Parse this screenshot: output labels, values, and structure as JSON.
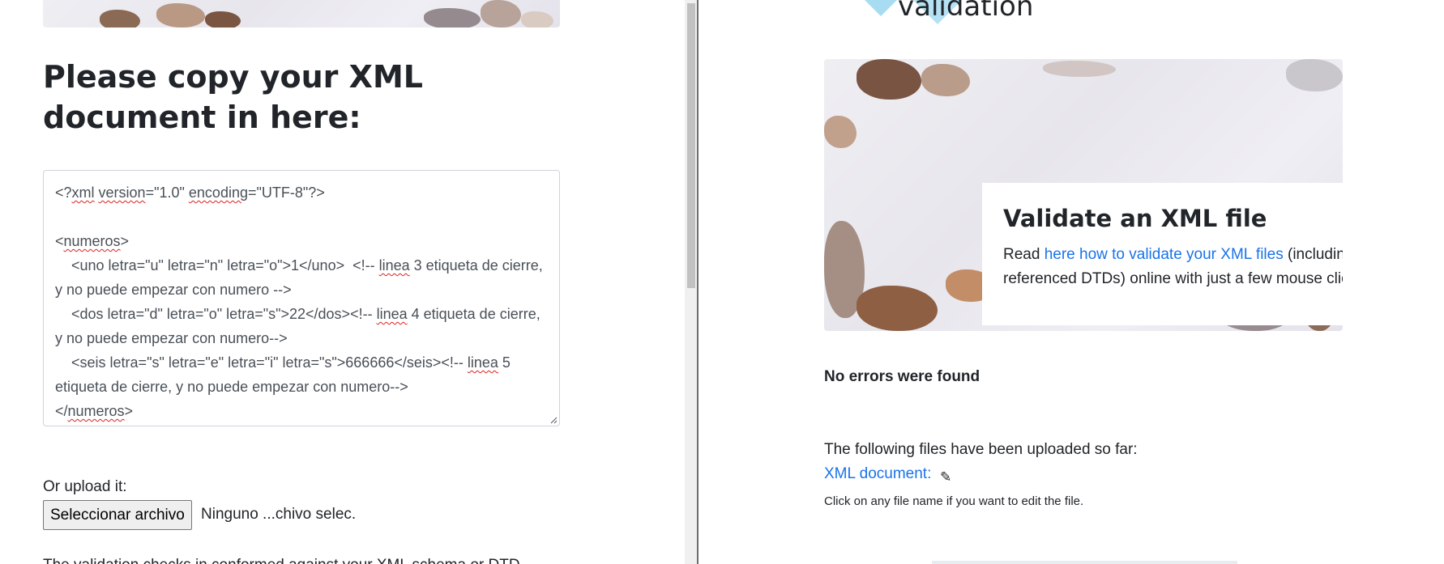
{
  "left": {
    "page_title": "Please copy your XML document in here:",
    "xml_lines": [
      "<?xml version=\"1.0\" encoding=\"UTF-8\"?>",
      "",
      "<numeros>",
      "    <uno letra=\"u\" letra=\"n\" letra=\"o\">1</uno>  <!-- linea 3 etiqueta de cierre, y no puede empezar con numero -->",
      "    <dos letra=\"d\" letra=\"o\" letra=\"s\">22</dos><!-- linea 4 etiqueta de cierre, y no puede empezar con numero-->",
      "    <seis letra=\"s\" letra=\"e\" letra=\"i\" letra=\"s\">666666</seis><!-- linea 5 etiqueta de cierre, y no puede empezar con numero-->",
      "</numeros>"
    ],
    "upload_label": "Or upload it:",
    "file_button_label": "Seleccionar archivo",
    "file_status": "Ninguno ...chivo selec.",
    "cutoff_text": "The validation checks in conformed against your XML schema or DTD"
  },
  "right": {
    "header_text": "validation",
    "card_title": "Validate an XML file",
    "card_text_before": "Read ",
    "card_link": "here how to validate your XML files",
    "card_text_after": " (including referenced DTDs) online with just a few mouse clicks.",
    "no_errors": "No errors were found",
    "files_intro": "The following files have been uploaded so far:",
    "xml_doc_link": "XML document:",
    "files_hint": "Click on any file name if you want to edit the file."
  },
  "colors": {
    "link": "#1a73e8",
    "logo": "#a8dcf2",
    "text": "#212529"
  },
  "icons": {
    "pencil": "pencil-icon",
    "resize": "resize-grip-icon"
  }
}
